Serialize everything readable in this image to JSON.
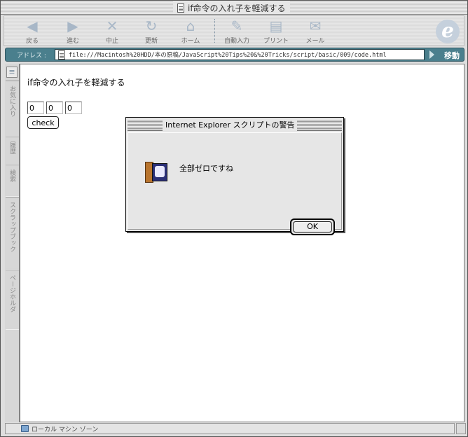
{
  "window": {
    "title": "if命令の入れ子を軽減する"
  },
  "toolbar": {
    "buttons": [
      {
        "label": "戻る",
        "icon": "back-arrow-icon"
      },
      {
        "label": "進む",
        "icon": "forward-arrow-icon"
      },
      {
        "label": "中止",
        "icon": "stop-icon"
      },
      {
        "label": "更新",
        "icon": "refresh-icon"
      },
      {
        "label": "ホーム",
        "icon": "home-icon"
      },
      {
        "label": "自動入力",
        "icon": "autofill-icon"
      },
      {
        "label": "プリント",
        "icon": "print-icon"
      },
      {
        "label": "メール",
        "icon": "mail-icon"
      }
    ]
  },
  "address_bar": {
    "label": "アドレス :",
    "url": "file:///Macintosh%20HDD/本の原稿/JavaScript%20Tips%20&%20Tricks/script/basic/009/code.html",
    "go_label": "移動"
  },
  "sidebar": {
    "tabs": [
      "お気に入り",
      "履歴",
      "検索",
      "スクラップブック",
      "ページホルダ"
    ]
  },
  "page": {
    "heading": "if命令の入れ子を軽減する",
    "inputs": [
      "0",
      "0",
      "0"
    ],
    "check_label": "check"
  },
  "dialog": {
    "title": "Internet Explorer スクリプトの警告",
    "message": "全部ゼロですね",
    "ok_label": "OK"
  },
  "status_bar": {
    "zone": "ローカル マシン ゾーン"
  },
  "colors": {
    "address_bar": "#4a7f8d",
    "toolbar_icon": "#a8b7c7"
  }
}
